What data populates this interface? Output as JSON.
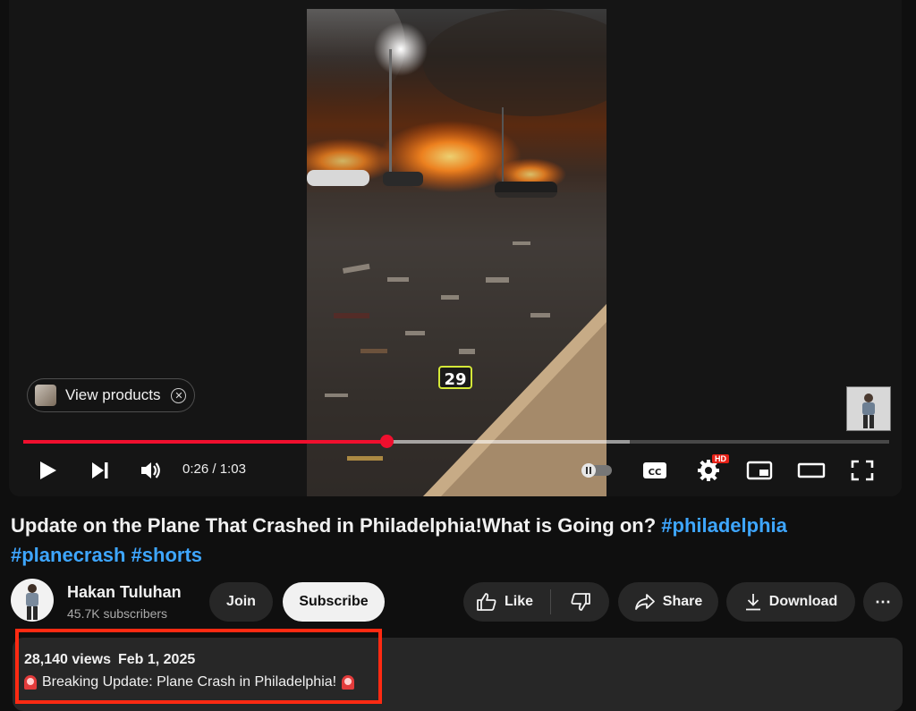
{
  "player": {
    "time_current": "0:26",
    "time_separator": " / ",
    "time_total": "1:03",
    "progress_fraction": 0.419,
    "buffered_fraction": 0.7,
    "overlay_number": "29",
    "view_products_label": "View products",
    "hd_badge": "HD",
    "accent_color": "#f00f2e",
    "icons": [
      "play-icon",
      "next-icon",
      "volume-icon",
      "autoplay-toggle-icon",
      "captions-icon",
      "settings-icon",
      "miniplayer-icon",
      "theater-mode-icon",
      "fullscreen-icon"
    ]
  },
  "video": {
    "title": "Update on the Plane That Crashed in Philadelphia!What is Going on?",
    "hashtags": [
      "#philadelphia",
      "#planecrash",
      "#shorts"
    ]
  },
  "channel": {
    "name": "Hakan Tuluhan",
    "subscribers": "45.7K subscribers",
    "join_label": "Join",
    "subscribe_label": "Subscribe"
  },
  "actions": {
    "like_label": "Like",
    "share_label": "Share",
    "download_label": "Download",
    "more_label": "⋯"
  },
  "description": {
    "views": "28,140 views",
    "date": "Feb 1, 2025",
    "text": "Breaking Update: Plane Crash in Philadelphia!",
    "highlight_color": "#ff2a12"
  }
}
